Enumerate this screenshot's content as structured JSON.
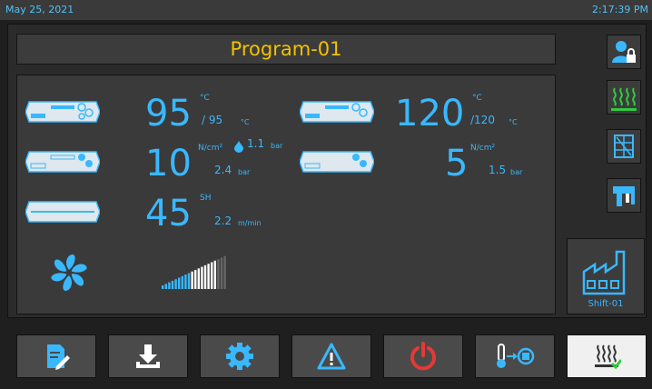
{
  "status": {
    "date": "May 25, 2021",
    "time": "2:17:39 PM"
  },
  "program": {
    "title": "Program-01"
  },
  "readings": {
    "r1": {
      "value": "95",
      "unit": "°C",
      "set": "/  95",
      "set_unit": "°C"
    },
    "r2": {
      "value": "120",
      "unit": "°C",
      "set": "/120",
      "set_unit": "°C"
    },
    "r3": {
      "value": "10",
      "unit": "N/cm²",
      "extra": "1.1",
      "extra_unit": "bar",
      "sub": "2.4",
      "sub_unit": "bar"
    },
    "r4": {
      "value": "5",
      "unit": "N/cm²",
      "sub": "1.5",
      "sub_unit": "bar"
    },
    "r5": {
      "value": "45",
      "unit": "SH",
      "sub": "2.2",
      "sub_unit": "m/min"
    }
  },
  "level_bar": {
    "level": 0.85
  },
  "sidebar": {
    "items": [
      {
        "icon": "user-lock-icon"
      },
      {
        "icon": "heating-icon"
      },
      {
        "icon": "grid-tool-icon"
      },
      {
        "icon": "machine-tool-icon"
      }
    ],
    "shift": {
      "icon": "factory-icon",
      "label": "Shift-01"
    }
  },
  "toolbar": {
    "buttons": [
      {
        "icon": "edit-document-icon"
      },
      {
        "icon": "download-icon"
      },
      {
        "icon": "gear-icon"
      },
      {
        "icon": "warning-icon"
      },
      {
        "icon": "power-icon"
      },
      {
        "icon": "temperature-stop-icon"
      },
      {
        "icon": "heater-active-icon"
      }
    ]
  },
  "colors": {
    "accent": "#39b8ff",
    "title": "#f2c200",
    "power": "#e53935",
    "heat_green": "#2ecc40"
  }
}
